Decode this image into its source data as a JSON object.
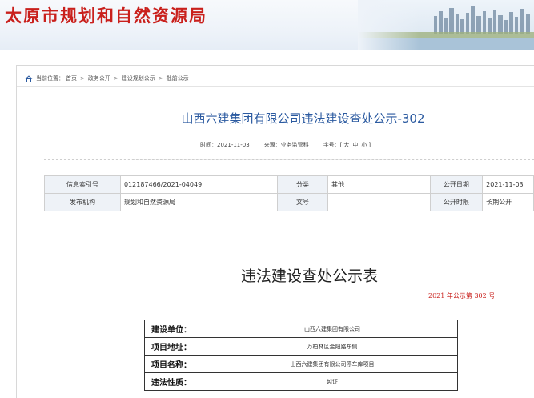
{
  "header": {
    "site_title": "太原市规划和自然资源局"
  },
  "breadcrumb": {
    "prefix": "当前位置：",
    "items": [
      "首页",
      "政务公开",
      "建设规划公示",
      "批前公示"
    ],
    "separator": ">"
  },
  "article": {
    "title": "山西六建集团有限公司违法建设查处公示-302",
    "meta": {
      "time": "时间：2021-11-03",
      "source": "来源：业务监管科",
      "font_label": "字号：[",
      "font_large": "大",
      "font_medium": "中",
      "font_small": "小",
      "font_close": "]"
    }
  },
  "info_table": {
    "row1": {
      "l1": "信息索引号",
      "v1": "012187466/2021-04049",
      "l2": "分类",
      "v2": "其他",
      "l3": "公开日期",
      "v3": "2021-11-03"
    },
    "row2": {
      "l1": "发布机构",
      "v1": "规划和自然资源局",
      "l2": "文号",
      "v2": "",
      "l3": "公开时限",
      "v3": "长期公开"
    }
  },
  "notice": {
    "title": "违法建设查处公示表",
    "number": "2021 年公示第 302 号",
    "rows": [
      {
        "label": "建设单位：",
        "value": "山西六建集团有限公司"
      },
      {
        "label": "项目地址：",
        "value": "万柏林区金阳路东侧"
      },
      {
        "label": "项目名称：",
        "value": "山西六建集团有限公司停车库项目"
      },
      {
        "label": "违法性质：",
        "value": "越证"
      }
    ]
  },
  "colors": {
    "brand_red": "#c9201c",
    "title_blue": "#2b5aa0",
    "label_bg": "#eef2f7"
  }
}
